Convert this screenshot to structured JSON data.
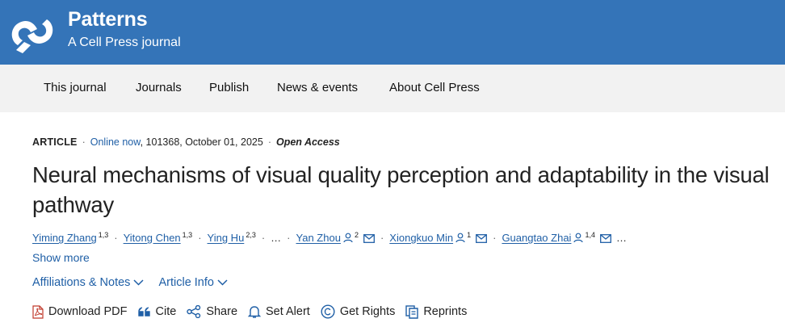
{
  "brand": {
    "title": "Patterns",
    "subtitle": "A Cell Press journal",
    "color": "#3474b8"
  },
  "nav": {
    "items": [
      "This journal",
      "Journals",
      "Publish",
      "News & events",
      "About Cell Press"
    ]
  },
  "meta": {
    "type": "ARTICLE",
    "status": "Online now",
    "details": ", 101368, October 01, 2025",
    "access": "Open Access",
    "separator": "·"
  },
  "article": {
    "title": "Neural mechanisms of visual quality perception and adaptability in the visual pathway"
  },
  "authors": {
    "list": [
      {
        "name": "Yiming Zhang",
        "sup": "1,3"
      },
      {
        "name": "Yitong Chen",
        "sup": "1,3"
      },
      {
        "name": "Ying Hu",
        "sup": "2,3"
      },
      {
        "name": "Yan Zhou",
        "sup": "2"
      },
      {
        "name": "Xiongkuo Min",
        "sup": "1"
      },
      {
        "name": "Guangtao Zhai",
        "sup": "1,4"
      }
    ],
    "ellipsis": "…",
    "show_more": "Show more"
  },
  "info": {
    "affiliations": "Affiliations & Notes",
    "article_info": "Article Info"
  },
  "actions": {
    "download_pdf": "Download PDF",
    "cite": "Cite",
    "share": "Share",
    "set_alert": "Set Alert",
    "get_rights": "Get Rights",
    "reprints": "Reprints"
  },
  "icons": [
    "patterns-logo",
    "person-icon",
    "mail-icon",
    "chevron-down-icon",
    "pdf-icon",
    "quote-icon",
    "share-icon",
    "bell-icon",
    "copyright-icon",
    "reprints-icon"
  ]
}
